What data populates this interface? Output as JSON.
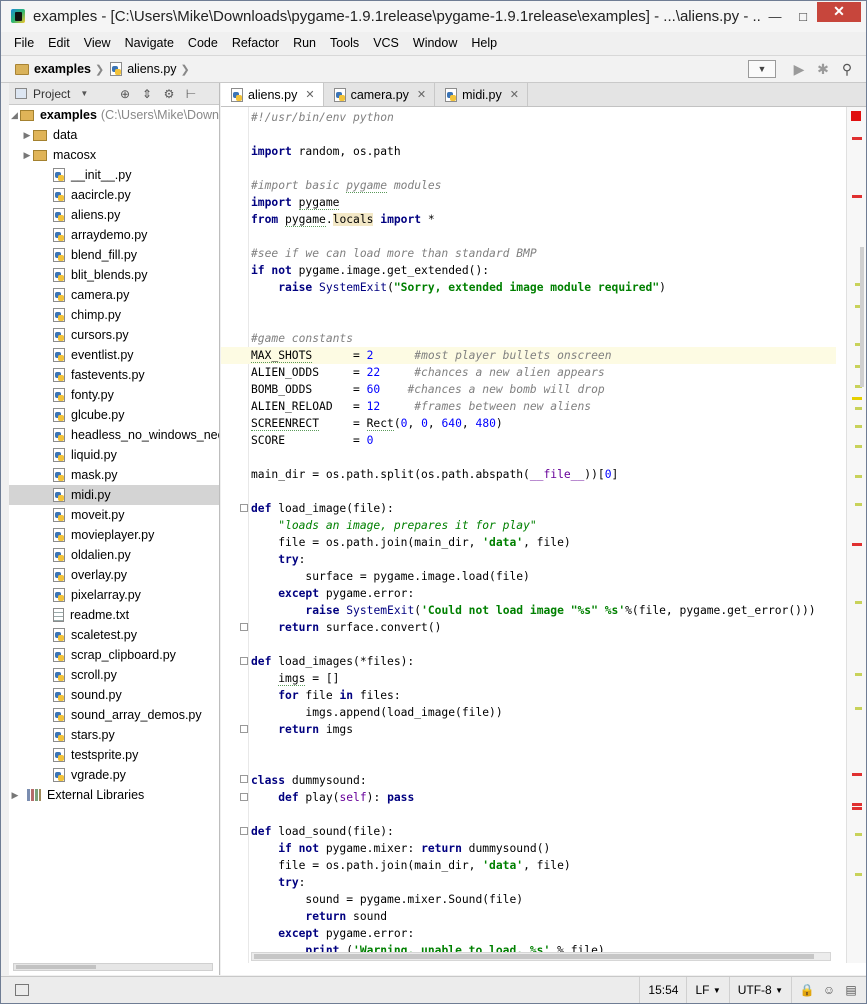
{
  "window": {
    "title": "examples - [C:\\Users\\Mike\\Downloads\\pygame-1.9.1release\\pygame-1.9.1release\\examples] - ...\\aliens.py - ...",
    "minimize": "—",
    "maximize": "□",
    "close": "✕"
  },
  "menu": [
    "File",
    "Edit",
    "View",
    "Navigate",
    "Code",
    "Refactor",
    "Run",
    "Tools",
    "VCS",
    "Window",
    "Help"
  ],
  "breadcrumb": {
    "folder": "examples",
    "file": "aliens.py"
  },
  "project_panel": {
    "title": "Project",
    "root_label": "examples",
    "root_path": "(C:\\Users\\Mike\\Down",
    "folders": [
      "data",
      "macosx"
    ],
    "files": [
      "__init__.py",
      "aacircle.py",
      "aliens.py",
      "arraydemo.py",
      "blend_fill.py",
      "blit_blends.py",
      "camera.py",
      "chimp.py",
      "cursors.py",
      "eventlist.py",
      "fastevents.py",
      "fonty.py",
      "glcube.py",
      "headless_no_windows_needed.py",
      "liquid.py",
      "mask.py",
      "midi.py",
      "moveit.py",
      "movieplayer.py",
      "oldalien.py",
      "overlay.py",
      "pixelarray.py",
      "readme.txt",
      "scaletest.py",
      "scrap_clipboard.py",
      "scroll.py",
      "sound.py",
      "sound_array_demos.py",
      "stars.py",
      "testsprite.py",
      "vgrade.py"
    ],
    "selected_file": "midi.py",
    "external": "External Libraries"
  },
  "tabs": [
    "aliens.py",
    "camera.py",
    "midi.py"
  ],
  "active_tab": "aliens.py",
  "status": {
    "position": "15:54",
    "line_sep": "LF",
    "encoding": "UTF-8"
  },
  "colors": {
    "keyword": "#000080",
    "comment": "#808080",
    "string": "#008000",
    "number": "#0000ff",
    "selection": "#d4d4d4",
    "error": "#e01010"
  },
  "icons": [
    "python-file-icon",
    "folder-icon",
    "text-file-icon",
    "libraries-icon",
    "run-icon",
    "debug-icon",
    "search-icon",
    "gear-icon"
  ]
}
